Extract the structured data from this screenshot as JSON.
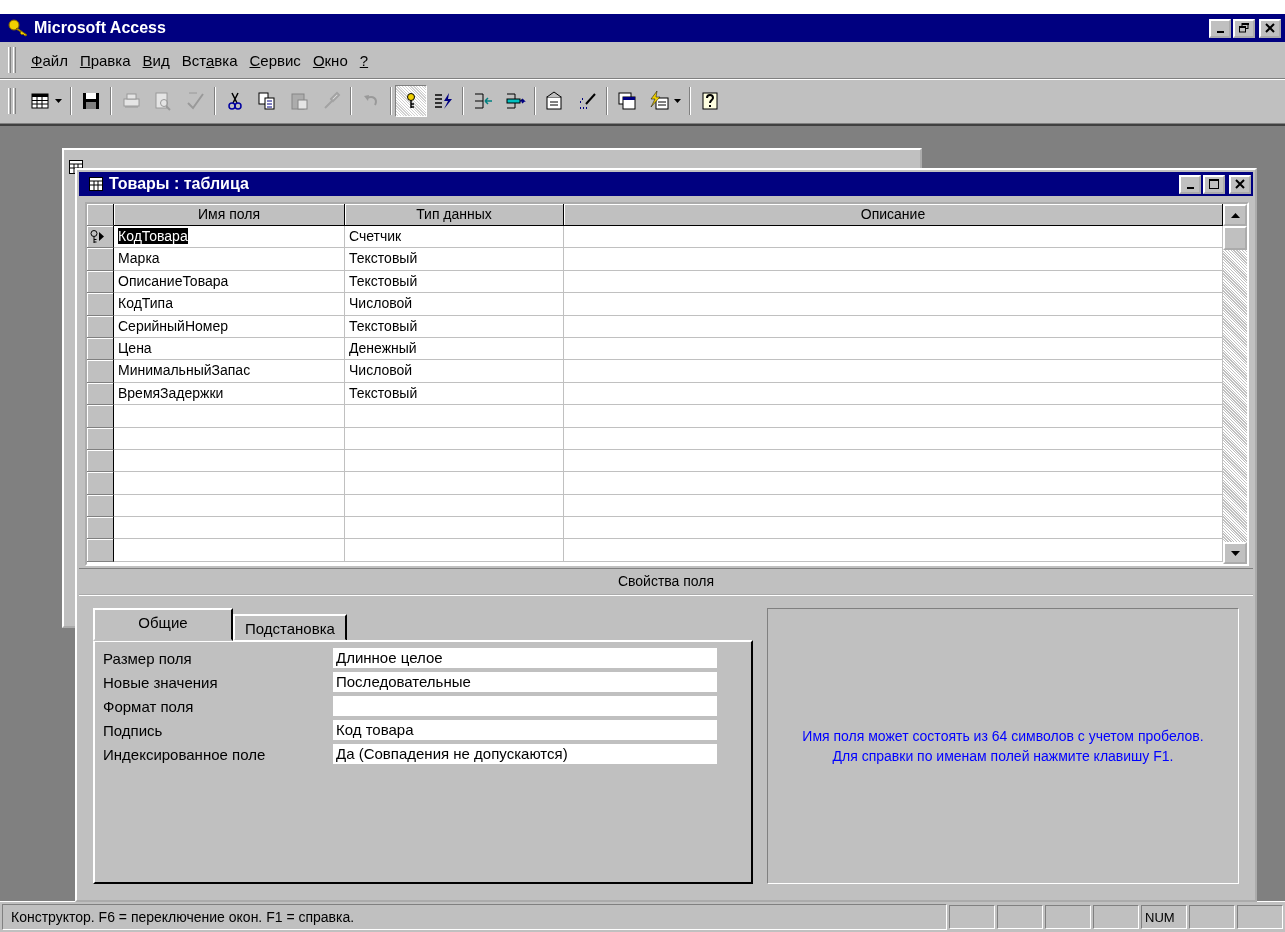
{
  "app_window": {
    "title": "Microsoft Access"
  },
  "menu": [
    {
      "accel": "Ф",
      "after": "айл"
    },
    {
      "accel": "П",
      "after": "равка"
    },
    {
      "accel": "В",
      "after": "ид"
    },
    {
      "before": "Вст",
      "accel": "а",
      "after": "вка"
    },
    {
      "accel": "С",
      "after": "ервис"
    },
    {
      "accel": "О",
      "after": "кно"
    },
    {
      "accel": "?"
    }
  ],
  "toolbar": [
    {
      "kind": "view",
      "disabled": false,
      "pressed": false,
      "dropdown": true
    },
    {
      "kind": "separator"
    },
    {
      "kind": "save",
      "disabled": false,
      "pressed": false,
      "dropdown": false
    },
    {
      "kind": "separator"
    },
    {
      "kind": "print",
      "disabled": true,
      "pressed": false,
      "dropdown": false
    },
    {
      "kind": "preview",
      "disabled": true,
      "pressed": false,
      "dropdown": false
    },
    {
      "kind": "spelling",
      "disabled": true,
      "pressed": false,
      "dropdown": false
    },
    {
      "kind": "separator"
    },
    {
      "kind": "cut",
      "disabled": false,
      "pressed": false,
      "dropdown": false
    },
    {
      "kind": "copy",
      "disabled": false,
      "pressed": false,
      "dropdown": false
    },
    {
      "kind": "paste",
      "disabled": true,
      "pressed": false,
      "dropdown": false
    },
    {
      "kind": "brush",
      "disabled": true,
      "pressed": false,
      "dropdown": false
    },
    {
      "kind": "separator"
    },
    {
      "kind": "undo",
      "disabled": true,
      "pressed": false,
      "dropdown": false
    },
    {
      "kind": "separator"
    },
    {
      "kind": "key",
      "disabled": false,
      "pressed": true,
      "dropdown": false
    },
    {
      "kind": "indexes",
      "disabled": false,
      "pressed": false,
      "dropdown": false
    },
    {
      "kind": "separator"
    },
    {
      "kind": "insert_rows",
      "disabled": false,
      "pressed": false,
      "dropdown": false
    },
    {
      "kind": "delete_rows",
      "disabled": false,
      "pressed": false,
      "dropdown": false
    },
    {
      "kind": "separator"
    },
    {
      "kind": "properties",
      "disabled": false,
      "pressed": false,
      "dropdown": false
    },
    {
      "kind": "build",
      "disabled": false,
      "pressed": false,
      "dropdown": false
    },
    {
      "kind": "separator"
    },
    {
      "kind": "database_window",
      "disabled": false,
      "pressed": false,
      "dropdown": false
    },
    {
      "kind": "new_object",
      "disabled": false,
      "pressed": false,
      "dropdown": true
    },
    {
      "kind": "separator"
    },
    {
      "kind": "help",
      "disabled": false,
      "pressed": false,
      "dropdown": false
    }
  ],
  "table_window": {
    "title": "Товары : таблица",
    "columns": [
      "Имя поля",
      "Тип данных",
      "Описание"
    ],
    "rows": [
      {
        "name": "КодТовара",
        "type": "Счетчик",
        "current": true,
        "primary_key": true
      },
      {
        "name": "Марка",
        "type": "Текстовый",
        "current": false,
        "primary_key": false
      },
      {
        "name": "ОписаниеТовара",
        "type": "Текстовый",
        "current": false,
        "primary_key": false
      },
      {
        "name": "КодТипа",
        "type": "Числовой",
        "current": false,
        "primary_key": false
      },
      {
        "name": "СерийныйНомер",
        "type": "Текстовый",
        "current": false,
        "primary_key": false
      },
      {
        "name": "Цена",
        "type": "Денежный",
        "current": false,
        "primary_key": false
      },
      {
        "name": "МинимальныйЗапас",
        "type": "Числовой",
        "current": false,
        "primary_key": false
      },
      {
        "name": "ВремяЗадержки",
        "type": "Текстовый",
        "current": false,
        "primary_key": false
      }
    ],
    "properties_title": "Свойства поля",
    "tabs": [
      {
        "label": "Общие",
        "selected": true
      },
      {
        "label": "Подстановка",
        "selected": false
      }
    ],
    "properties": [
      {
        "label": "Размер поля",
        "value": "Длинное целое"
      },
      {
        "label": "Новые значения",
        "value": "Последовательные"
      },
      {
        "label": "Формат поля"
      },
      {
        "label": "Подпись",
        "value": "Код товара"
      },
      {
        "label": "Индексированное поле",
        "value": "Да (Совпадения не допускаются)"
      }
    ],
    "hint": "Имя поля может состоять из 64 символов с учетом пробелов.  Для справки по именам полей нажмите клавишу F1."
  },
  "status_bar": {
    "message": "Конструктор.  F6 = переключение окон.  F1 = справка.",
    "indicators": [
      {
        "text": "NUM"
      }
    ]
  }
}
